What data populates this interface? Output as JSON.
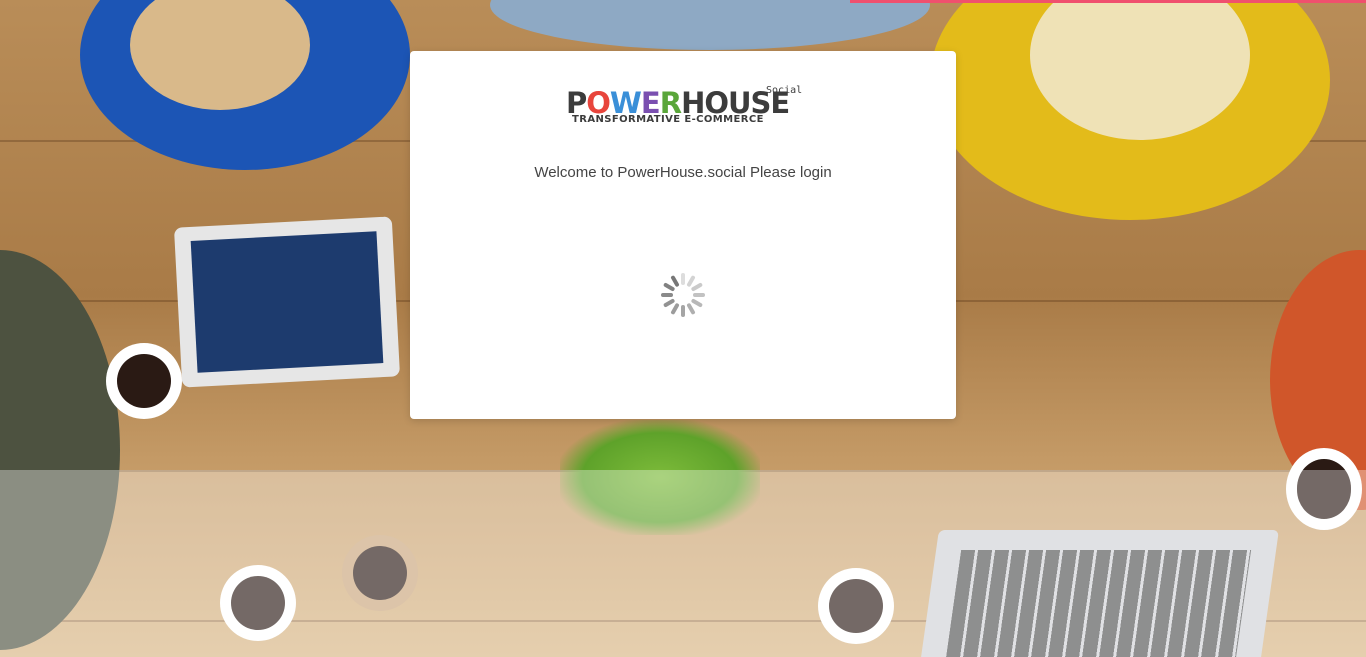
{
  "logo": {
    "word": [
      "P",
      "O",
      "W",
      "E",
      "R",
      "HOUSE"
    ],
    "word_colors": [
      "#3c3c3c",
      "#e8453c",
      "#3a8fd8",
      "#7a4fb0",
      "#5aa63a",
      "#3c3c3c"
    ],
    "tagline": "TRANSFORMATIVE E-COMMERCE",
    "suffix": ".Social"
  },
  "welcome_text": "Welcome to PowerHouse.social Please login",
  "spinner": {
    "state": "loading"
  },
  "colors": {
    "accent_bar": "#f0506e",
    "card_bg": "#ffffff",
    "text": "#444444"
  }
}
